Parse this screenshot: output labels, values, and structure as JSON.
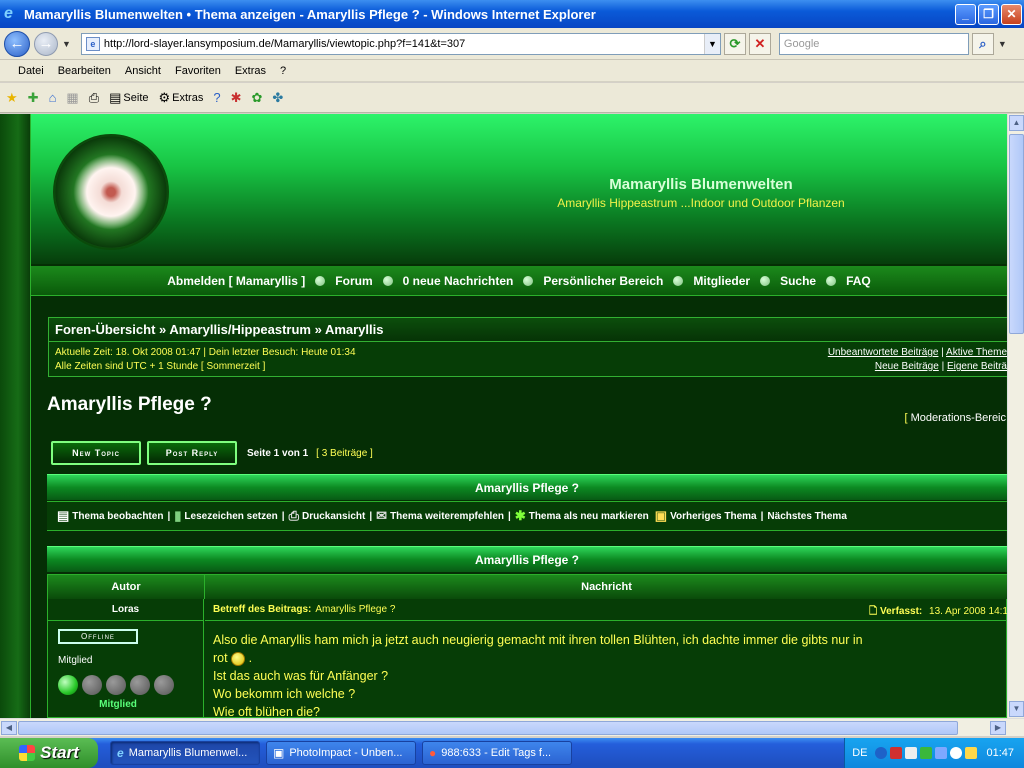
{
  "window": {
    "title": "Mamaryllis Blumenwelten • Thema anzeigen - Amaryllis Pflege ? - Windows Internet Explorer"
  },
  "address": {
    "url": "http://lord-slayer.lansymposium.de/Mamaryllis/viewtopic.php?f=141&t=307",
    "search_placeholder": "Google"
  },
  "menu": [
    "Datei",
    "Bearbeiten",
    "Ansicht",
    "Favoriten",
    "Extras",
    "?"
  ],
  "commandbar": {
    "page_label": "Seite",
    "extras_label": "Extras"
  },
  "site": {
    "title": "Mamaryllis Blumenwelten",
    "description": "Amaryllis Hippeastrum ...Indoor und Outdoor Pflanzen"
  },
  "nav": [
    "Abmelden [ Mamaryllis ]",
    "Forum",
    "0 neue Nachrichten",
    "Persönlicher Bereich",
    "Mitglieder",
    "Suche",
    "FAQ"
  ],
  "breadcrumb": "Foren-Übersicht » Amaryllis/Hippeastrum » Amaryllis",
  "info": {
    "line1": "Aktuelle Zeit: 18. Okt 2008 01:47 | Dein letzter Besuch: Heute 01:34",
    "line2": "Alle Zeiten sind UTC + 1 Stunde [ Sommerzeit ]"
  },
  "quicklinks": {
    "unanswered": "Unbeantwortete Beiträge",
    "active": "Aktive Theme",
    "new_posts": "Neue Beiträge",
    "own_posts": "Eigene Beiträ"
  },
  "topic": {
    "title": "Amaryllis Pflege ?",
    "moderation": "Moderations-Bereic",
    "new_topic": "New Topic",
    "post_reply": "Post Reply",
    "page_info": "Seite 1 von 1",
    "post_count": "[ 3 Beiträge ]",
    "bar_title": "Amaryllis Pflege ?"
  },
  "tools": [
    "Thema beobachten",
    "Lesezeichen setzen",
    "Druckansicht",
    "Thema weiterempfehlen",
    "Thema als neu markieren",
    "Vorheriges Thema",
    "Nächstes Thema"
  ],
  "post": {
    "col_author": "Autor",
    "col_message": "Nachricht",
    "author": "Loras",
    "status": "Offline",
    "rank": "Mitglied",
    "rank_title": "Mitglied",
    "rank_level": 1,
    "rank_max": 5,
    "subject_label": "Betreff des Beitrags:",
    "subject": "Amaryllis Pflege ?",
    "posted_label": "Verfasst:",
    "posted": "13. Apr 2008 14:1",
    "lines": [
      "Also die Amaryllis ham mich ja jetzt auch neugierig gemacht mit ihren tollen Blühten, ich dachte immer die gibts nur in",
      "rot",
      ".",
      "Ist das auch was für Anfänger ?",
      "Wo bekomm ich welche ?",
      "Wie oft blühen die?"
    ]
  },
  "taskbar": {
    "start": "Start",
    "tasks": [
      "Mamaryllis Blumenwel...",
      "PhotoImpact - Unben...",
      "988:633 - Edit Tags f..."
    ],
    "lang": "DE",
    "clock": "01:47"
  }
}
